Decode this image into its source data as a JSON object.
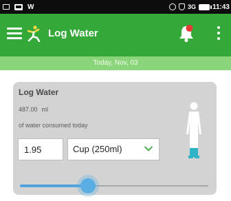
{
  "status_bar": {
    "carrier_mark": "W",
    "signal_text": "3G",
    "time": "11:43"
  },
  "app_bar": {
    "title": "Log Water",
    "menu_icon": "hamburger-menu-icon",
    "logo_icon": "fitness-figure-logo-icon",
    "notification_icon": "bell-icon",
    "more_icon": "overflow-menu-icon",
    "colors": {
      "bar": "#35a83a",
      "badge": "#e53935"
    }
  },
  "date_banner": {
    "text": "Today, Nov, 03"
  },
  "card": {
    "title": "Log Water",
    "consumed_amount": "487.00",
    "consumed_unit": "ml",
    "consumed_caption": "of water consumed today",
    "quantity_value": "1.95",
    "unit_selected": "Cup (250ml)",
    "figure_icon": "human-body-water-level-icon",
    "slider_fraction": 0.36,
    "colors": {
      "card": "#d3d3d3",
      "accent": "#4ea3dc",
      "chevron": "#35a83a"
    }
  }
}
